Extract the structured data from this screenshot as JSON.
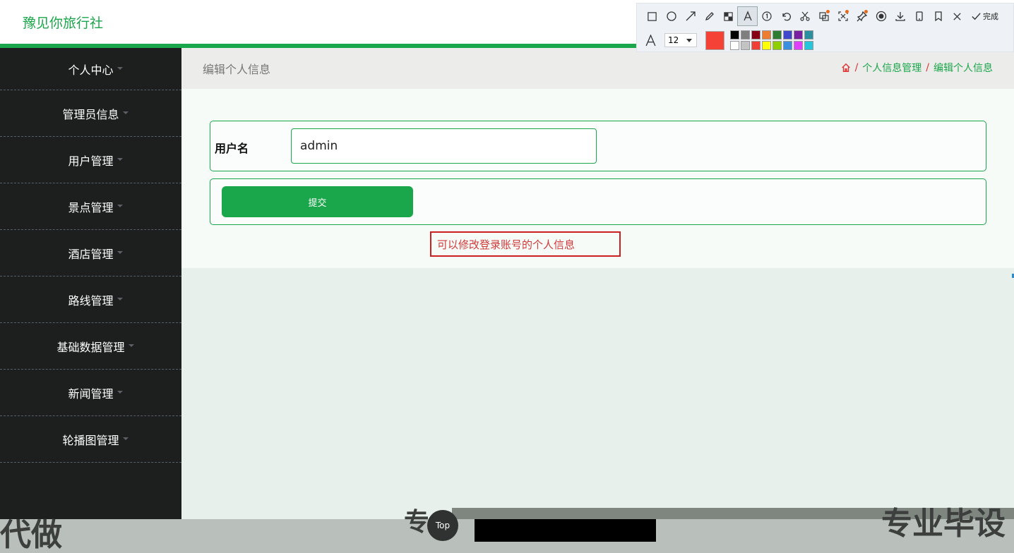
{
  "header": {
    "brand": "豫见你旅行社"
  },
  "sidebar": {
    "items": [
      {
        "label": "个人中心"
      },
      {
        "label": "管理员信息"
      },
      {
        "label": "用户管理"
      },
      {
        "label": "景点管理"
      },
      {
        "label": "酒店管理"
      },
      {
        "label": "路线管理"
      },
      {
        "label": "基础数据管理"
      },
      {
        "label": "新闻管理"
      },
      {
        "label": "轮播图管理"
      }
    ]
  },
  "breadcrumb": {
    "page_title": "编辑个人信息",
    "items": [
      "个人信息管理",
      "编辑个人信息"
    ],
    "separator": "/"
  },
  "form": {
    "username_label": "用户名",
    "username_value": "admin",
    "submit_label": "提交"
  },
  "annotation": {
    "note_text": "可以修改登录账号的个人信息"
  },
  "toolbar": {
    "done_label": "完成",
    "font_size": "12",
    "current_color": "#f44336",
    "palette": [
      "#000000",
      "#7f7f7f",
      "#880015",
      "#ed7d31",
      "#2e7d32",
      "#3f48cc",
      "#7b1fa2",
      "#2a8f9e",
      "#ffffff",
      "#c3c3c3",
      "#ef3e36",
      "#ffff00",
      "#8fce00",
      "#3b8fde",
      "#e040fb",
      "#26c6da"
    ],
    "icons": [
      "rectangle-icon",
      "ellipse-icon",
      "arrow-icon",
      "pencil-icon",
      "mosaic-icon",
      "text-icon",
      "number-icon",
      "undo-icon",
      "cut-icon",
      "ocr-icon",
      "crop-icon",
      "pin-icon",
      "record-icon",
      "download-icon",
      "device-icon",
      "bookmark-icon",
      "close-icon",
      "check-icon"
    ]
  },
  "overlay": {
    "top_button": "Top",
    "big_left": "代做",
    "big_mid": "专",
    "big_right": "专业毕设"
  },
  "colors": {
    "accent": "#1aa64a",
    "sidebar_bg": "#1d1f1e",
    "note_red": "#cc1f1f"
  }
}
